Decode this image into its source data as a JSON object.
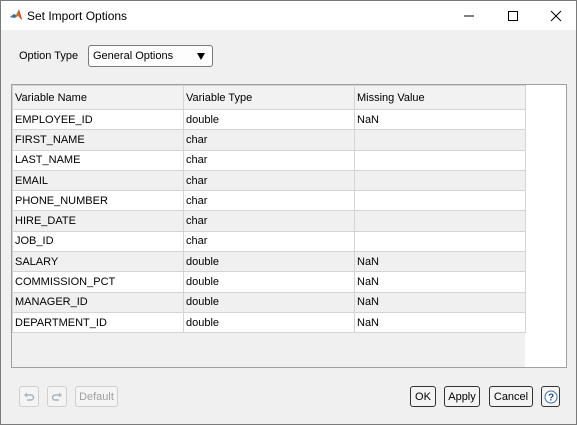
{
  "window": {
    "title": "Set Import Options"
  },
  "options": {
    "label": "Option Type",
    "selected": "General Options"
  },
  "table": {
    "headers": [
      "Variable Name",
      "Variable Type",
      "Missing Value"
    ],
    "rows": [
      [
        "EMPLOYEE_ID",
        "double",
        "NaN"
      ],
      [
        "FIRST_NAME",
        "char",
        ""
      ],
      [
        "LAST_NAME",
        "char",
        ""
      ],
      [
        "EMAIL",
        "char",
        ""
      ],
      [
        "PHONE_NUMBER",
        "char",
        ""
      ],
      [
        "HIRE_DATE",
        "char",
        ""
      ],
      [
        "JOB_ID",
        "char",
        ""
      ],
      [
        "SALARY",
        "double",
        "NaN"
      ],
      [
        "COMMISSION_PCT",
        "double",
        "NaN"
      ],
      [
        "MANAGER_ID",
        "double",
        "NaN"
      ],
      [
        "DEPARTMENT_ID",
        "double",
        "NaN"
      ]
    ]
  },
  "buttons": {
    "default": "Default",
    "ok": "OK",
    "apply": "Apply",
    "cancel": "Cancel",
    "help": "?"
  },
  "icons": {
    "app": "matlab-logo-icon",
    "minimize": "minimize-icon",
    "maximize": "maximize-icon",
    "close": "close-icon",
    "undo": "undo-icon",
    "redo": "redo-icon"
  }
}
